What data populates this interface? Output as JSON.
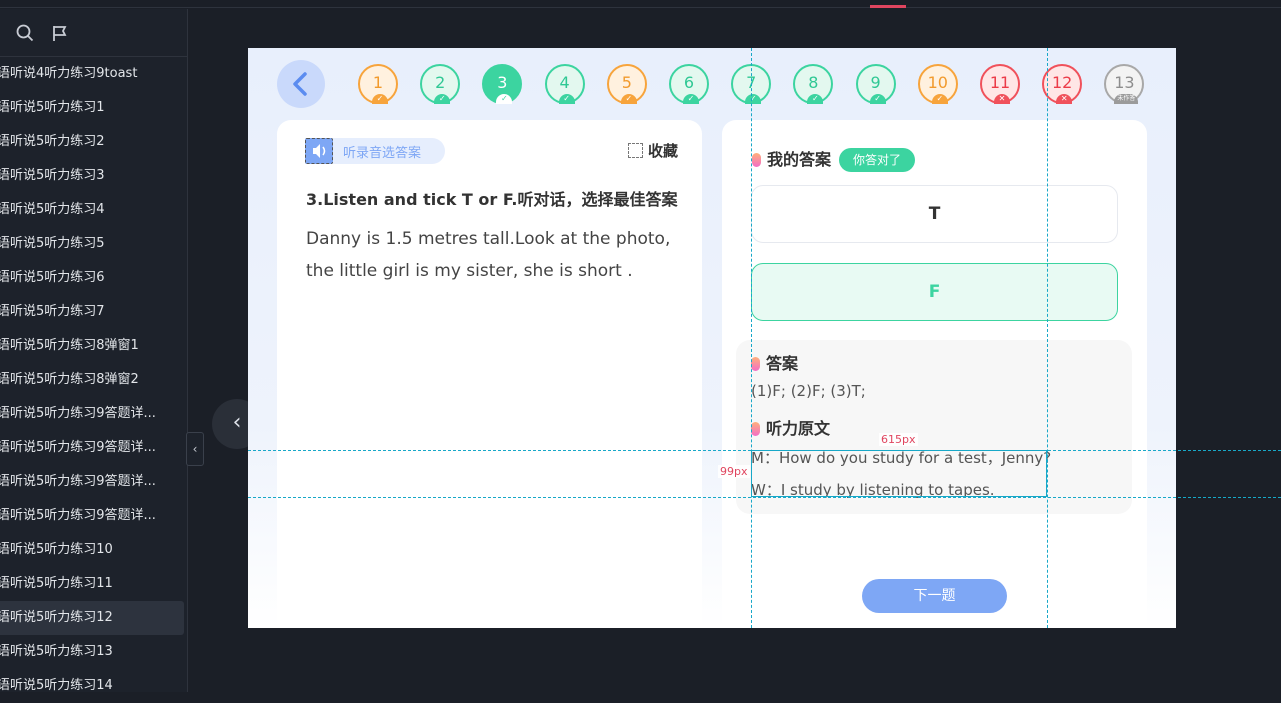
{
  "sidebar": {
    "items": [
      {
        "label": "语听说4听力练习9toast"
      },
      {
        "label": "语听说5听力练习1"
      },
      {
        "label": "语听说5听力练习2"
      },
      {
        "label": "语听说5听力练习3"
      },
      {
        "label": "语听说5听力练习4"
      },
      {
        "label": "语听说5听力练习5"
      },
      {
        "label": "语听说5听力练习6"
      },
      {
        "label": "语听说5听力练习7"
      },
      {
        "label": "语听说5听力练习8弹窗1"
      },
      {
        "label": "语听说5听力练习8弹窗2"
      },
      {
        "label": "语听说5听力练习9答题详..."
      },
      {
        "label": "语听说5听力练习9答题详..."
      },
      {
        "label": "语听说5听力练习9答题详..."
      },
      {
        "label": "语听说5听力练习9答题详..."
      },
      {
        "label": "语听说5听力练习10"
      },
      {
        "label": "语听说5听力练习11"
      },
      {
        "label": "语听说5听力练习12"
      },
      {
        "label": "语听说5听力练习13"
      },
      {
        "label": "语听说5听力练习14"
      }
    ],
    "active_index": 16
  },
  "question_nav": [
    {
      "n": "1",
      "status": "orange"
    },
    {
      "n": "2",
      "status": "green"
    },
    {
      "n": "3",
      "status": "current"
    },
    {
      "n": "4",
      "status": "green"
    },
    {
      "n": "5",
      "status": "orange"
    },
    {
      "n": "6",
      "status": "green"
    },
    {
      "n": "7",
      "status": "green"
    },
    {
      "n": "8",
      "status": "green"
    },
    {
      "n": "9",
      "status": "green"
    },
    {
      "n": "10",
      "status": "orange"
    },
    {
      "n": "11",
      "status": "red"
    },
    {
      "n": "12",
      "status": "red"
    },
    {
      "n": "13",
      "status": "gray",
      "tag": "未作答"
    }
  ],
  "question": {
    "listen_label": "听录音选答案",
    "favorite_label": "收藏",
    "title": "3.Listen and tick T or F.听对话，选择最佳答案",
    "body": "Danny is 1.5 metres tall.Look at the photo, the little girl is my sister, she is short ."
  },
  "answer_panel": {
    "my_answer_label": "我的答案",
    "result_badge": "你答对了",
    "option_t": "T",
    "option_f": "F",
    "answer_heading": "答案",
    "answer_text": "(1)F;    (2)F;     (3)T;",
    "transcript_heading": "听力原文",
    "transcript_m": "M：How do you study for a test，Jenny?",
    "transcript_w": "W：I study by listening to tapes.",
    "next_label": "下一题"
  },
  "measurements": {
    "width_label": "615px",
    "height_label": "99px"
  },
  "colors": {
    "accent_blue": "#7ea7f5",
    "correct_green": "#3cd4a0",
    "warn_orange": "#f7a43c",
    "wrong_red": "#f0515b",
    "guide_cyan": "#18a8c8",
    "measure_red": "#e0455f"
  }
}
